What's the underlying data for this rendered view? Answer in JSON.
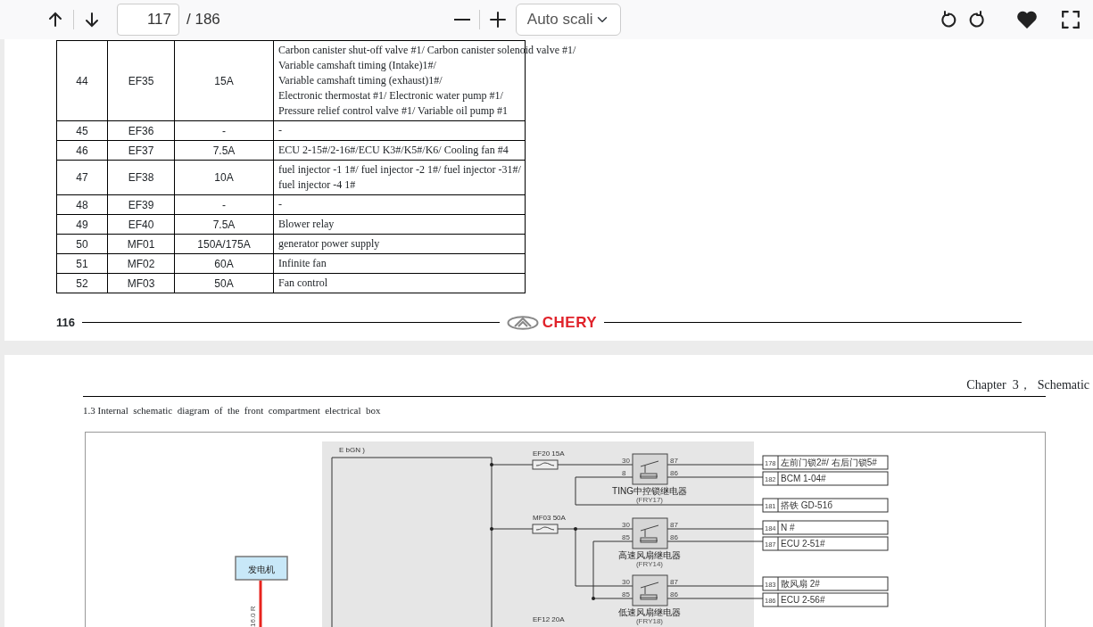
{
  "toolbar": {
    "page_input": "117",
    "page_count": "/ 186",
    "zoom_select": "Auto scali"
  },
  "page_1": {
    "table": {
      "rows": [
        {
          "no": "44",
          "fuse": "EF35",
          "rating": "15A",
          "description": [
            "Carbon  canister  shut-off  valve  #1/ Carbon  canister  solenoid  valve  #1/",
            "Variable  camshaft  timing (Intake)1#/",
            "Variable  camshaft  timing (exhaust)1#/",
            "Electronic  thermostat  #1/ Electronic  water  pump  #1/",
            "Pressure  relief  control  valve  #1/ Variable  oil  pump  #1"
          ]
        },
        {
          "no": "45",
          "fuse": "EF36",
          "rating": "-",
          "description": [
            "-"
          ]
        },
        {
          "no": "46",
          "fuse": "EF37",
          "rating": "7.5A",
          "description": [
            "ECU 2-15#/2-16#/ECU K3#/K5#/K6/ Cooling  fan  #4"
          ]
        },
        {
          "no": "47",
          "fuse": "EF38",
          "rating": "10A",
          "description": [
            "fuel  injector -1 1#/  fuel  injector -2 1#/  fuel  injector -31#/",
            "fuel  injector -4 1#"
          ]
        },
        {
          "no": "48",
          "fuse": "EF39",
          "rating": "-",
          "description": [
            "-"
          ]
        },
        {
          "no": "49",
          "fuse": "EF40",
          "rating": "7.5A",
          "description": [
            "Blower  relay"
          ]
        },
        {
          "no": "50",
          "fuse": "MF01",
          "rating": "150A/175A",
          "description": [
            "generator  power  supply"
          ]
        },
        {
          "no": "51",
          "fuse": "MF02",
          "rating": "60A",
          "description": [
            "Infinite  fan"
          ]
        },
        {
          "no": "52",
          "fuse": "MF03",
          "rating": "50A",
          "description": [
            "Fan  control"
          ]
        }
      ]
    },
    "footer": {
      "page_number": "116",
      "logo": "CHERY"
    }
  },
  "page_2": {
    "header": "Chapter  3，  Schematic",
    "caption": "1.3 Internal  schematic  diagram  of  the  front  compartment  electrical  box",
    "diagram": {
      "supply_label": "E  bGN  )",
      "fuses": [
        {
          "label": "EF20 15A"
        },
        {
          "label": "MF03 50A"
        },
        {
          "label": "EF12 20A"
        }
      ],
      "relays": [
        {
          "name": "TING中控锁继电器",
          "id": "(FRY17)",
          "pins": [
            "30",
            "8",
            "87",
            "86"
          ]
        },
        {
          "name": "高速风扇继电器",
          "id": "(FRY14)",
          "pins": [
            "30",
            "85",
            "87",
            "86"
          ]
        },
        {
          "name": "低速风扇继电器",
          "id": "(FRY18)",
          "pins": [
            "30",
            "85",
            "87",
            "86"
          ]
        }
      ],
      "connectors": [
        {
          "pin": "178",
          "label": "左前门锁2#/  右后门锁5#"
        },
        {
          "pin": "182",
          "label": "BCM 1-04#"
        },
        {
          "pin": "181",
          "label": "搭铁  GD-51б"
        },
        {
          "pin": "184",
          "label": "N  #"
        },
        {
          "pin": "187",
          "label": "ECU 2-51#"
        },
        {
          "pin": "183",
          "label": "散风扇  2#"
        },
        {
          "pin": "186",
          "label": "ECU 2-56#"
        }
      ],
      "generator": {
        "label": "发电机",
        "wire_label": "16.0 R"
      }
    }
  }
}
